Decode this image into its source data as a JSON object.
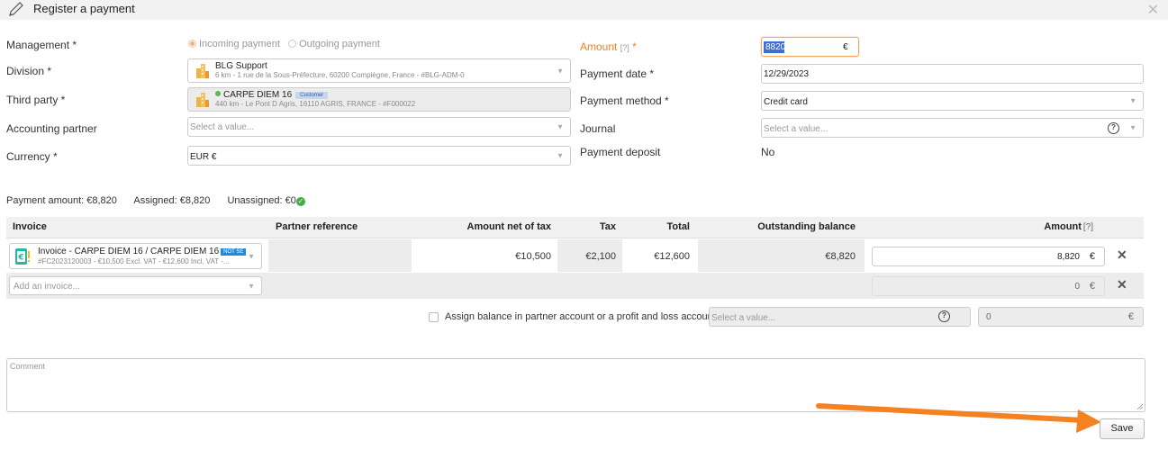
{
  "dialog": {
    "title": "Register a payment",
    "close_icon": "close-icon",
    "edit_icon": "pencil-icon"
  },
  "form": {
    "management": {
      "label": "Management *",
      "options": [
        "Incoming payment",
        "Outgoing payment"
      ],
      "selected": "Incoming payment"
    },
    "division": {
      "label": "Division *",
      "name": "BLG Support",
      "detail": "6 km - 1 rue de la Sous-Préfecture, 60200 Compiègne, France - #BLG-ADM-0"
    },
    "third_party": {
      "label": "Third party *",
      "name": "CARPE DIEM 16",
      "badge": "Customer",
      "detail": "440 km - Le Pont D Agris, 16110 AGRIS, FRANCE - #F000022"
    },
    "accounting_partner": {
      "label": "Accounting partner",
      "placeholder": "Select a value..."
    },
    "currency": {
      "label": "Currency *",
      "value": "EUR €"
    },
    "amount": {
      "label": "Amount",
      "help": "[?]",
      "required": "*",
      "value": "8820",
      "unit": "€"
    },
    "payment_date": {
      "label": "Payment date *",
      "value": "12/29/2023"
    },
    "payment_method": {
      "label": "Payment method *",
      "value": "Credit card"
    },
    "journal": {
      "label": "Journal",
      "placeholder": "Select a value..."
    },
    "payment_deposit": {
      "label": "Payment deposit",
      "value": "No"
    }
  },
  "summary": {
    "payment_amount": "Payment amount: €8,820",
    "assigned": "Assigned: €8,820",
    "unassigned": "Unassigned: €0",
    "ok_icon": "check-circle-icon"
  },
  "table": {
    "headers": {
      "invoice": "Invoice",
      "partner_reference": "Partner reference",
      "amount_net": "Amount net of tax",
      "tax": "Tax",
      "total": "Total",
      "outstanding": "Outstanding balance",
      "amount": "Amount",
      "amount_help": "[?]"
    },
    "rows": [
      {
        "invoice_title": "Invoice - CARPE DIEM 16 / CARPE DIEM 16",
        "status": "NOT SE",
        "invoice_detail": "#FC2023120003 - €10,500 Excl. VAT - €12,600 Incl. VAT -...",
        "amount_net": "€10,500",
        "tax": "€2,100",
        "total": "€12,600",
        "outstanding": "€8,820",
        "amount": "8,820",
        "unit": "€"
      }
    ],
    "add_row": {
      "placeholder": "Add an invoice...",
      "amount": "0",
      "unit": "€"
    }
  },
  "balance": {
    "label": "Assign balance in partner account or a profit and loss account",
    "placeholder": "Select a value...",
    "amount": "0",
    "unit": "€"
  },
  "comment": {
    "placeholder": "Comment"
  },
  "actions": {
    "save": "Save"
  },
  "colors": {
    "accent_orange": "#f58220",
    "badge_blue": "#1e8be0",
    "ok_green": "#3fae49"
  }
}
